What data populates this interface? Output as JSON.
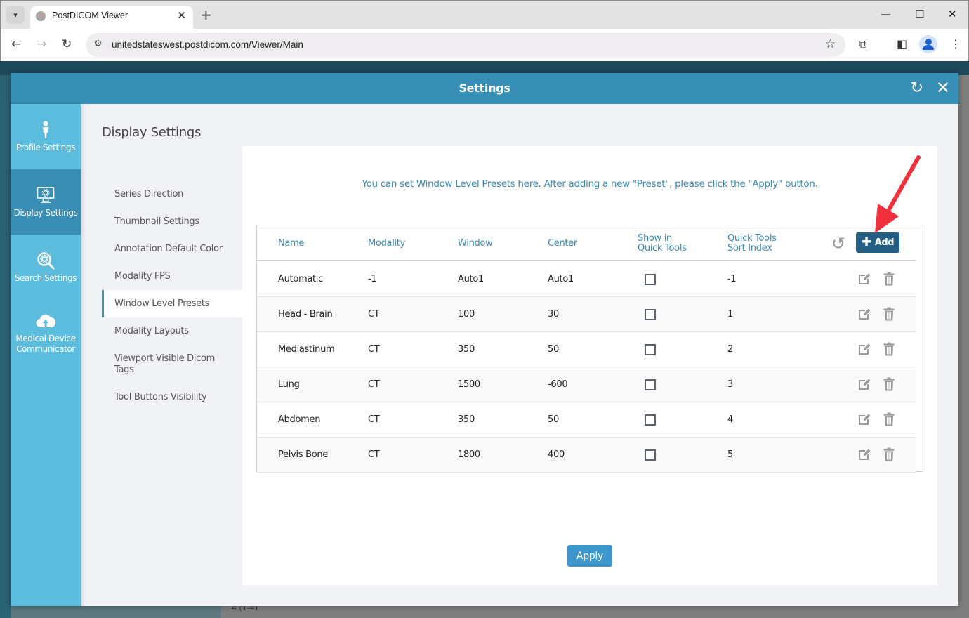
{
  "browser": {
    "tab_title": "PostDICOM Viewer",
    "url": "unitedstateswest.postdicom.com/Viewer/Main"
  },
  "background_app": {
    "footer_count": "4 (1-4)"
  },
  "modal": {
    "title": "Settings"
  },
  "categories": [
    {
      "label": "Profile Settings",
      "icon": "person-icon",
      "active": false
    },
    {
      "label": "Display Settings",
      "icon": "monitor-gear-icon",
      "active": true
    },
    {
      "label": "Search Settings",
      "icon": "search-gear-icon",
      "active": false
    },
    {
      "label": "Medical Device Communicator",
      "icon": "cloud-upload-icon",
      "active": false
    }
  ],
  "submenu": {
    "title": "Display Settings",
    "items": [
      {
        "label": "Series Direction",
        "active": false
      },
      {
        "label": "Thumbnail Settings",
        "active": false
      },
      {
        "label": "Annotation Default Color",
        "active": false
      },
      {
        "label": "Modality FPS",
        "active": false
      },
      {
        "label": "Window Level Presets",
        "active": true
      },
      {
        "label": "Modality Layouts",
        "active": false
      },
      {
        "label": "Viewport Visible Dicom Tags",
        "active": false
      },
      {
        "label": "Tool Buttons Visibility",
        "active": false
      }
    ]
  },
  "presets": {
    "info": "You can set Window Level Presets here. After adding a new \"Preset\", please click the \"Apply\" button.",
    "columns": {
      "name": "Name",
      "modality": "Modality",
      "window": "Window",
      "center": "Center",
      "show_line1": "Show in",
      "show_line2": "Quick Tools",
      "index_line1": "Quick Tools",
      "index_line2": "Sort Index"
    },
    "add_label": "Add",
    "rows": [
      {
        "name": "Automatic",
        "modality": "-1",
        "window": "Auto1",
        "center": "Auto1",
        "show_in_quick_tools": false,
        "sort_index": "-1"
      },
      {
        "name": "Head - Brain",
        "modality": "CT",
        "window": "100",
        "center": "30",
        "show_in_quick_tools": false,
        "sort_index": "1"
      },
      {
        "name": "Mediastinum",
        "modality": "CT",
        "window": "350",
        "center": "50",
        "show_in_quick_tools": false,
        "sort_index": "2"
      },
      {
        "name": "Lung",
        "modality": "CT",
        "window": "1500",
        "center": "-600",
        "show_in_quick_tools": false,
        "sort_index": "3"
      },
      {
        "name": "Abdomen",
        "modality": "CT",
        "window": "350",
        "center": "50",
        "show_in_quick_tools": false,
        "sort_index": "4"
      },
      {
        "name": "Pelvis Bone",
        "modality": "CT",
        "window": "1800",
        "center": "400",
        "show_in_quick_tools": false,
        "sort_index": "5"
      }
    ],
    "apply_label": "Apply"
  },
  "colors": {
    "header": "#378fb5",
    "nav": "#5bbcdd",
    "nav_active": "#3a8db3",
    "add_button": "#235f82",
    "apply_button": "#3d97cc",
    "accent_text": "#3b88b3",
    "annotation_arrow": "#f0303c"
  }
}
